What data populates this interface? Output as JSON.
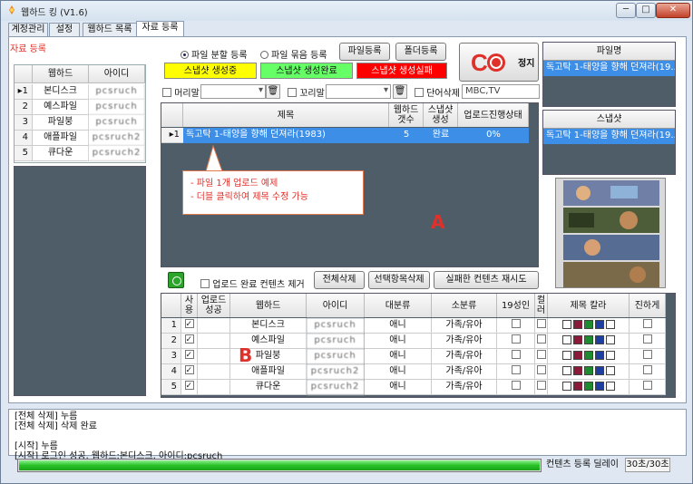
{
  "window": {
    "title": "웹하드 킹 (V1.6)",
    "min": "─",
    "max": "□",
    "close": "✕"
  },
  "tabs": [
    "계정관리",
    "설정",
    "웹하드 목록",
    "자료 등록"
  ],
  "section_title": "자료 등록",
  "left_grid": {
    "headers": [
      "웹하드",
      "아이디"
    ],
    "rows": [
      {
        "num": "1",
        "name": "본디스크",
        "id": "pcsruch"
      },
      {
        "num": "2",
        "name": "예스파일",
        "id": "pcsruch"
      },
      {
        "num": "3",
        "name": "파일붕",
        "id": "pcsruch"
      },
      {
        "num": "4",
        "name": "애플파일",
        "id": "pcsruch2"
      },
      {
        "num": "5",
        "name": "큐다운",
        "id": "pcsruch2"
      }
    ]
  },
  "upload_mode": {
    "option1": "파일 분할 등록",
    "option2": "파일 묶음 등록"
  },
  "buttons": {
    "file_register": "파일등록",
    "folder_register": "폴더등록",
    "stop": "정지",
    "delete_all": "전체삭제",
    "delete_selected": "선택항목삭제",
    "retry_failed": "실패한 컨텐츠 재시도"
  },
  "snapshot_status": {
    "in_progress": "스냅샷 생성중",
    "complete": "스냅샷 생성완료",
    "failed": "스냅샷 생성실패"
  },
  "status_colors": {
    "in_progress": "#ffff00",
    "complete": "#66ff66",
    "failed": "#ff0000"
  },
  "options": {
    "header_label": "머리말",
    "footer_label": "꼬리말",
    "word_delete_label": "단어삭제",
    "word_delete_value": "MBC,TV",
    "remove_completed_label": "업로드 완료 컨텐츠 제거"
  },
  "main_grid": {
    "headers": [
      "제목",
      "웹하드 갯수",
      "스냅샷 생성",
      "업로드진행상태"
    ],
    "rows": [
      {
        "num": "1",
        "title": "독고탁 1-태양을 향해 던져라(1983)",
        "count": "5",
        "snapshot": "완료",
        "progress": "0%"
      }
    ]
  },
  "callout": {
    "line1": "-  파일 1개 업로드 예제",
    "line2": "-  더블 클릭하여 제목 수정 가능"
  },
  "label_a": "A",
  "label_b": "B",
  "file_panel": {
    "title": "파일명",
    "value": "독고탁 1-태양을 향해 던져라(19..."
  },
  "snapshot_panel": {
    "title": "스냅샷",
    "value": "독고탁 1-태양을 향해 던져라(19..."
  },
  "bottom_grid": {
    "headers": [
      "사용",
      "업로드 성공",
      "웹하드",
      "아이디",
      "대분류",
      "소분류",
      "19성인",
      "컬러",
      "제목 칼라",
      "진하게"
    ],
    "rows": [
      {
        "num": "1",
        "name": "본디스크",
        "id": "pcsruch",
        "cat1": "애니",
        "cat2": "가족/유아"
      },
      {
        "num": "2",
        "name": "예스파일",
        "id": "pcsruch",
        "cat1": "애니",
        "cat2": "가족/유아"
      },
      {
        "num": "3",
        "name": "파일붕",
        "id": "pcsruch",
        "cat1": "애니",
        "cat2": "가족/유아"
      },
      {
        "num": "4",
        "name": "애플파일",
        "id": "pcsruch2",
        "cat1": "애니",
        "cat2": "가족/유아"
      },
      {
        "num": "5",
        "name": "큐다운",
        "id": "pcsruch2",
        "cat1": "애니",
        "cat2": "가족/유아"
      }
    ],
    "title_colors": [
      "#ffffff",
      "#8b1a3a",
      "#1e8c2e",
      "#1f3fa0",
      "#ffffff"
    ]
  },
  "log_lines": [
    "[전체 삭제] 누름",
    "[전체 삭제] 삭제 완료",
    "",
    "[시작] 누름",
    "[시작] 로그인 성공, 웹하드:본디스크, 아이디:pcsruch"
  ],
  "status_bar": {
    "label": "컨텐츠 등록 딜레이",
    "delay": "30초/30초",
    "progress_fraction": 1.0
  }
}
